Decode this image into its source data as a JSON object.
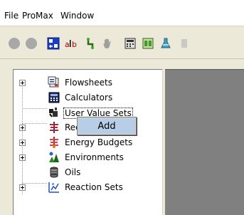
{
  "menu": {
    "items": [
      "File",
      "ProMax",
      "Window"
    ]
  },
  "toolbar": {
    "icons": [
      "circle-icon",
      "circle-icon",
      "grid-icon",
      "a-b-icon",
      "connector-icon",
      "hand-icon",
      "calculator-icon",
      "table-icon",
      "flask-icon"
    ]
  },
  "tree": {
    "items": [
      {
        "label": "Flowsheets",
        "expandable": true,
        "icon": "flowsheet-icon"
      },
      {
        "label": "Calculators",
        "expandable": false,
        "icon": "calculator-icon"
      },
      {
        "label": "User Value Sets",
        "expandable": false,
        "icon": "user-value-sets-icon",
        "selected": true
      },
      {
        "label": "Recove",
        "expandable": true,
        "icon": "recovery-icon"
      },
      {
        "label": "Energy Budgets",
        "expandable": true,
        "icon": "energy-budget-icon"
      },
      {
        "label": "Environments",
        "expandable": true,
        "icon": "environment-icon"
      },
      {
        "label": "Oils",
        "expandable": false,
        "icon": "oils-icon"
      },
      {
        "label": "Reaction Sets",
        "expandable": true,
        "icon": "reaction-sets-icon"
      }
    ]
  },
  "context_menu": {
    "items": [
      {
        "label": "Add"
      }
    ]
  },
  "colors": {
    "window_bg": "#ece9d8",
    "tree_bg": "#ffffff",
    "right_pane_bg": "#808080",
    "menu_highlight": "#b8cde6"
  }
}
